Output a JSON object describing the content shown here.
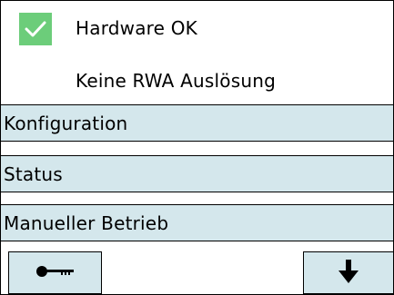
{
  "status": {
    "hardware_label": "Hardware OK",
    "rwa_label": "Keine RWA Auslösung",
    "check_icon": "checkmark-icon",
    "check_color": "#6ccd7a"
  },
  "menu": {
    "items": [
      {
        "label": "Konfiguration"
      },
      {
        "label": "Status"
      },
      {
        "label": "Manueller Betrieb"
      }
    ],
    "bg_color": "#d4e7ec"
  },
  "footer": {
    "left_icon": "key-icon",
    "right_icon": "arrow-down-icon"
  }
}
